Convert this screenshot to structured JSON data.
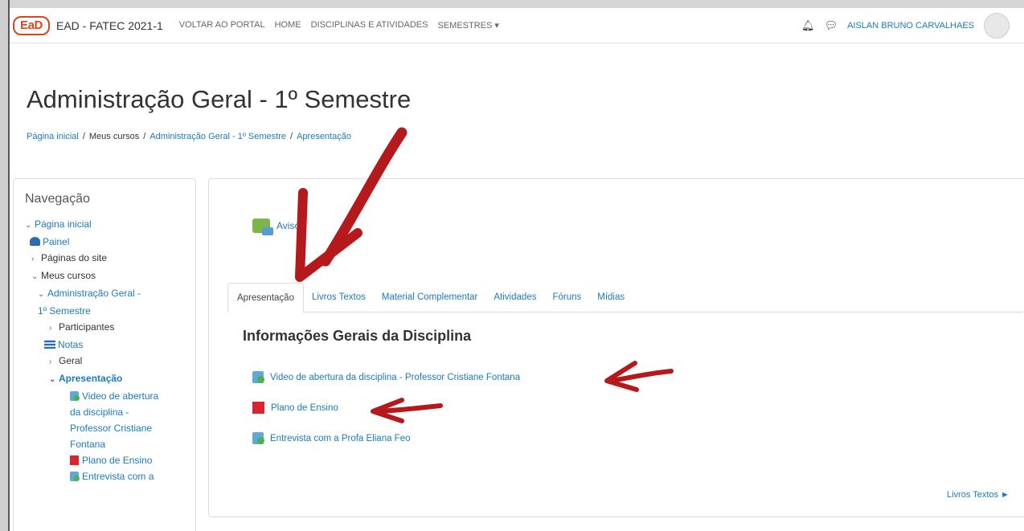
{
  "navbar": {
    "logo_text": "EaD",
    "site_name": "EAD - FATEC 2021-1",
    "links": [
      "VOLTAR AO PORTAL",
      "HOME",
      "DISCIPLINAS e ATIVIDADES",
      "SEMESTRES ▾"
    ],
    "user_name": "AISLAN BRUNO CARVALHAES"
  },
  "page": {
    "title": "Administração Geral - 1º Semestre",
    "breadcrumb": [
      "Página inicial",
      "Meus cursos",
      "Administração Geral - 1º Semestre",
      "Apresentação"
    ]
  },
  "sidebar": {
    "title": "Navegação",
    "items": [
      {
        "label": "Página inicial"
      },
      {
        "label": "Painel"
      },
      {
        "label": "Páginas do site"
      },
      {
        "label": "Meus cursos"
      },
      {
        "label": "Administração Geral -"
      },
      {
        "label": "1º Semestre"
      },
      {
        "label": "Participantes"
      },
      {
        "label": "Notas"
      },
      {
        "label": "Geral"
      },
      {
        "label": "Apresentação"
      },
      {
        "label": "Video de abertura"
      },
      {
        "label": "da disciplina -"
      },
      {
        "label": "Professor Cristiane"
      },
      {
        "label": "Fontana"
      },
      {
        "label": "Plano de Ensino"
      },
      {
        "label": "Entrevista com a"
      }
    ]
  },
  "main": {
    "forum_link": "Avisos",
    "tabs": [
      "Apresentação",
      "Livros Textos",
      "Material Complementar",
      "Atividades",
      "Fóruns",
      "Mídias"
    ],
    "active_tab": "Apresentação",
    "section_title": "Informações Gerais da Disciplina",
    "activities": [
      {
        "label": "Video de abertura da disciplina - Professor Cristiane Fontana",
        "icon": "video-icon"
      },
      {
        "label": "Plano de Ensino",
        "icon": "pdf-icon"
      },
      {
        "label": "Entrevista com a Profa Eliana Feo",
        "icon": "video-icon"
      }
    ],
    "next_section_link": "Livros Textos ►"
  },
  "colors": {
    "link": "#1a7bbf",
    "logo": "#d9451c",
    "annotation_arrow": "#b5191c"
  }
}
